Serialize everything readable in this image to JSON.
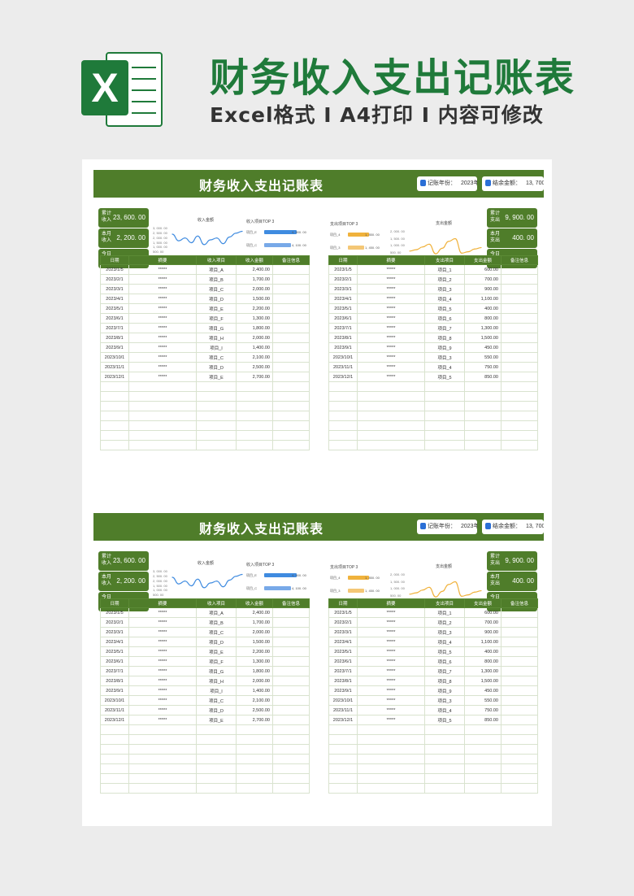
{
  "header": {
    "logo_letter": "X",
    "title": "财务收入支出记账表",
    "subtitle": "Excel格式 I A4打印 I 内容可修改"
  },
  "sheet": {
    "title": "财务收入支出记账表",
    "year_label": "记账年份：",
    "year": "2023年",
    "balance_label": "结余金额：",
    "balance": "13, 700. 00"
  },
  "kpis_left": [
    {
      "label": "累计收入",
      "value": "23, 600. 00"
    },
    {
      "label": "本月收入",
      "value": "2, 200. 00"
    },
    {
      "label": "今日收入",
      "value": "-"
    }
  ],
  "kpis_right": [
    {
      "label": "累计支出",
      "value": "9, 900. 00"
    },
    {
      "label": "本月支出",
      "value": "400. 00"
    },
    {
      "label": "今日支出",
      "value": "-"
    }
  ],
  "income_line_title": "收入金额",
  "income_top_title": "收入项目TOP 3",
  "expense_top_title": "支出项目TOP 3",
  "expense_line_title": "支出金额",
  "income_columns": [
    "日期",
    "摘要",
    "收入项目",
    "收入金额",
    "备注信息"
  ],
  "expense_columns": [
    "日期",
    "摘要",
    "支出项目",
    "支出金额",
    "备注信息"
  ],
  "income_rows": [
    [
      "2023/1/5",
      "*****",
      "项目_A",
      "2,400.00",
      ""
    ],
    [
      "2023/2/1",
      "*****",
      "项目_B",
      "1,700.00",
      ""
    ],
    [
      "2023/3/1",
      "*****",
      "项目_C",
      "2,000.00",
      ""
    ],
    [
      "2023/4/1",
      "*****",
      "项目_D",
      "1,500.00",
      ""
    ],
    [
      "2023/5/1",
      "*****",
      "项目_E",
      "2,200.00",
      ""
    ],
    [
      "2023/6/1",
      "*****",
      "项目_F",
      "1,300.00",
      ""
    ],
    [
      "2023/7/1",
      "*****",
      "项目_G",
      "1,800.00",
      ""
    ],
    [
      "2023/8/1",
      "*****",
      "项目_H",
      "2,000.00",
      ""
    ],
    [
      "2023/9/1",
      "*****",
      "项目_I",
      "1,400.00",
      ""
    ],
    [
      "2023/10/1",
      "*****",
      "项目_C",
      "2,100.00",
      ""
    ],
    [
      "2023/11/1",
      "*****",
      "项目_D",
      "2,500.00",
      ""
    ],
    [
      "2023/12/1",
      "*****",
      "项目_E",
      "2,700.00",
      ""
    ]
  ],
  "expense_rows": [
    [
      "2023/1/5",
      "*****",
      "项目_1",
      "600.00",
      ""
    ],
    [
      "2023/2/1",
      "*****",
      "项目_2",
      "700.00",
      ""
    ],
    [
      "2023/3/1",
      "*****",
      "项目_3",
      "900.00",
      ""
    ],
    [
      "2023/4/1",
      "*****",
      "项目_4",
      "1,100.00",
      ""
    ],
    [
      "2023/5/1",
      "*****",
      "项目_5",
      "400.00",
      ""
    ],
    [
      "2023/6/1",
      "*****",
      "项目_6",
      "800.00",
      ""
    ],
    [
      "2023/7/1",
      "*****",
      "项目_7",
      "1,300.00",
      ""
    ],
    [
      "2023/8/1",
      "*****",
      "项目_8",
      "1,500.00",
      ""
    ],
    [
      "2023/9/1",
      "*****",
      "项目_9",
      "450.00",
      ""
    ],
    [
      "2023/10/1",
      "*****",
      "项目_3",
      "550.00",
      ""
    ],
    [
      "2023/11/1",
      "*****",
      "项目_4",
      "750.00",
      ""
    ],
    [
      "2023/12/1",
      "*****",
      "项目_5",
      "850.00",
      ""
    ]
  ],
  "blank_rows": 7,
  "colors": {
    "green": "#4f7d2a",
    "income_line": "#3f8be0",
    "expense_line": "#f0b23c"
  },
  "chart_data": [
    {
      "type": "line",
      "title": "收入金额",
      "x": [
        1,
        2,
        3,
        4,
        5,
        6,
        7,
        8,
        9,
        10,
        11,
        12
      ],
      "y_ticks": [
        "3, 000. 00",
        "2, 500. 00",
        "2, 000. 00",
        "1, 500. 00",
        "1, 000. 00",
        "500. 00",
        "-"
      ],
      "ylim": [
        0,
        3000
      ],
      "values": [
        2400,
        1700,
        2000,
        1500,
        2200,
        1300,
        1800,
        2000,
        1400,
        2100,
        2500,
        2700
      ]
    },
    {
      "type": "bar",
      "title": "收入项目TOP 3",
      "categories": [
        "项目_E",
        "项目_C",
        "项目_D"
      ],
      "labels": [
        "4, 900. 00",
        "4, 100. 00",
        "4, 000. 00"
      ],
      "values": [
        4900,
        4100,
        4000
      ],
      "colors": [
        "#3f8be0",
        "#78a9e8",
        "#b6cfef"
      ]
    },
    {
      "type": "bar",
      "title": "支出项目TOP 3",
      "categories": [
        "项目_4",
        "项目_3",
        "项目_5"
      ],
      "labels": [
        "1, 850. 00",
        "1, 450. 00",
        "1, 250. 00"
      ],
      "values": [
        1850,
        1450,
        1250
      ],
      "colors": [
        "#f0b23c",
        "#f4c776",
        "#f7dba6"
      ]
    },
    {
      "type": "line",
      "title": "支出金额",
      "x": [
        1,
        2,
        3,
        4,
        5,
        6,
        7,
        8,
        9,
        10,
        11,
        12
      ],
      "y_ticks": [
        "2, 000. 00",
        "1, 500. 00",
        "1, 000. 00",
        "500. 00",
        "-"
      ],
      "ylim": [
        0,
        2000
      ],
      "values": [
        600,
        700,
        900,
        1100,
        400,
        800,
        1300,
        1500,
        450,
        550,
        750,
        850
      ]
    }
  ]
}
